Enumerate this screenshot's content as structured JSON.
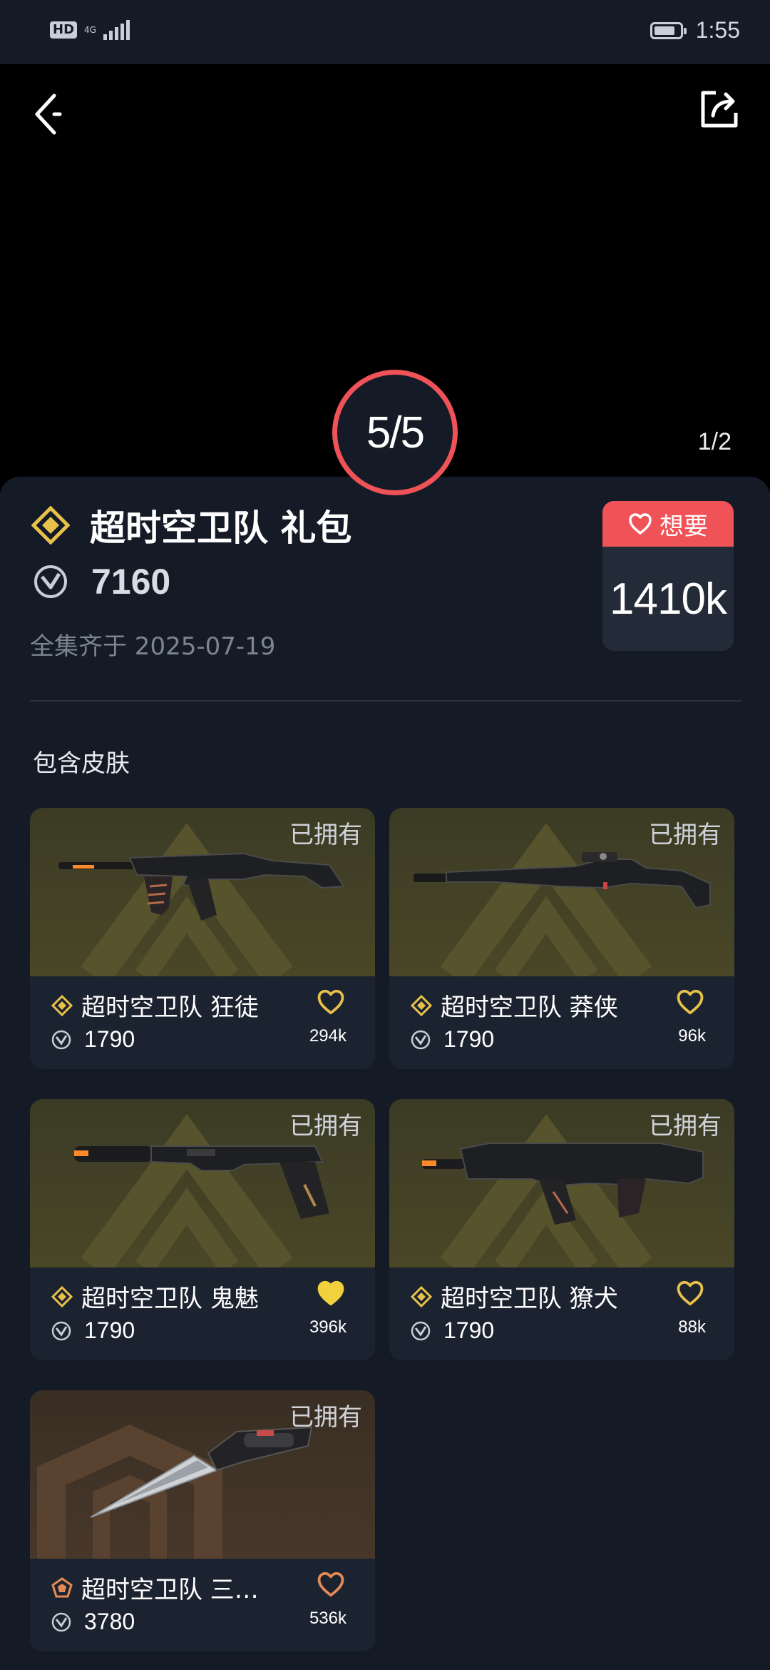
{
  "status_bar": {
    "hd": "HD",
    "network": "4G",
    "time": "1:55"
  },
  "media": {
    "pager": "1/2"
  },
  "bundle": {
    "collected_badge": "5/5",
    "title": "超时空卫队 礼包",
    "price": "7160",
    "completed_text": "全集齐于 2025-07-19",
    "want_label": "想要",
    "want_count": "1410k"
  },
  "section_title": "包含皮肤",
  "skins": [
    {
      "owned": "已拥有",
      "name": "超时空卫队 狂徒",
      "price": "1790",
      "likes": "294k",
      "liked": false,
      "tier": "gold",
      "weapon": "rifle-icon"
    },
    {
      "owned": "已拥有",
      "name": "超时空卫队 莽侠",
      "price": "1790",
      "likes": "96k",
      "liked": false,
      "tier": "gold",
      "weapon": "sniper-icon"
    },
    {
      "owned": "已拥有",
      "name": "超时空卫队 鬼魅",
      "price": "1790",
      "likes": "396k",
      "liked": true,
      "tier": "gold",
      "weapon": "pistol-icon"
    },
    {
      "owned": "已拥有",
      "name": "超时空卫队 獠犬",
      "price": "1790",
      "likes": "88k",
      "liked": false,
      "tier": "gold",
      "weapon": "smg-icon"
    },
    {
      "owned": "已拥有",
      "name": "超时空卫队 三…",
      "price": "3780",
      "likes": "536k",
      "liked": false,
      "tier": "orange",
      "weapon": "knife-icon"
    }
  ],
  "colors": {
    "accent_red": "#ef5257",
    "gold": "#e8c14a",
    "orange_tier": "#e58a55",
    "background": "#141b27"
  }
}
